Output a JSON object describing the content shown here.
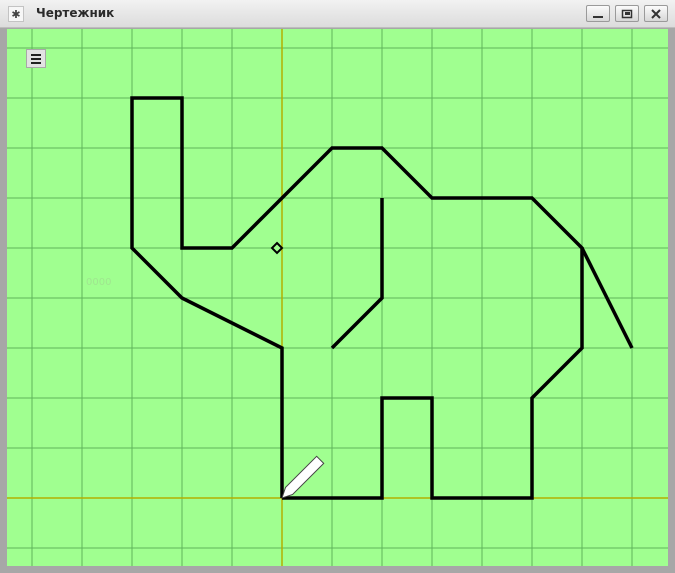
{
  "window": {
    "title": "Чертежник",
    "app_icon": "pin-icon",
    "controls": [
      "minimize-icon",
      "restore-icon",
      "close-icon"
    ]
  },
  "canvas": {
    "background_color": "#a0ff90",
    "grid_color": "#5fb45a",
    "axis_color": "#b3b000",
    "drawing_color": "#000000",
    "menu_icon": "hamburger-menu-icon",
    "faint_label": "0000"
  },
  "drawing": {
    "grid_step": 1,
    "origin": [
      0,
      0
    ],
    "outline_points": [
      [
        0,
        0
      ],
      [
        2,
        0
      ],
      [
        2,
        2
      ],
      [
        3,
        2
      ],
      [
        3,
        0
      ],
      [
        5,
        0
      ],
      [
        5,
        2
      ],
      [
        6,
        3
      ],
      [
        6,
        5
      ],
      [
        5,
        6
      ],
      [
        3,
        6
      ],
      [
        2,
        7
      ],
      [
        1,
        7
      ],
      [
        0,
        6
      ],
      [
        -1,
        5
      ],
      [
        -2,
        5
      ],
      [
        -2,
        8
      ],
      [
        -3,
        8
      ],
      [
        -3,
        5
      ],
      [
        -2,
        4
      ],
      [
        0,
        3
      ],
      [
        0,
        0
      ]
    ],
    "inner_line": [
      [
        1,
        3
      ],
      [
        2,
        4
      ],
      [
        2,
        6
      ]
    ],
    "tail_line": [
      [
        6,
        5
      ],
      [
        7,
        3
      ]
    ],
    "eye_point": [
      -0.1,
      5
    ],
    "pen_position": [
      0,
      0
    ]
  }
}
